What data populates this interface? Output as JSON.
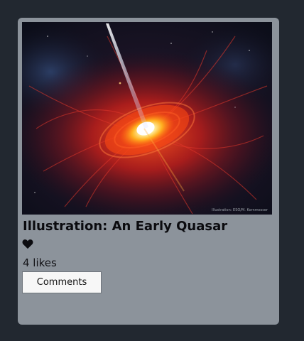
{
  "post": {
    "title": "Illustration: An Early Quasar",
    "image_credit": "Illustration: ESO/M. Kornmesser",
    "likes_text": "4 likes",
    "comments_label": "Comments",
    "heart_icon": "heart-icon",
    "liked": true
  },
  "colors": {
    "page_background": "#222830",
    "card_background": "#8c939b",
    "button_background": "#f7f7f7"
  }
}
